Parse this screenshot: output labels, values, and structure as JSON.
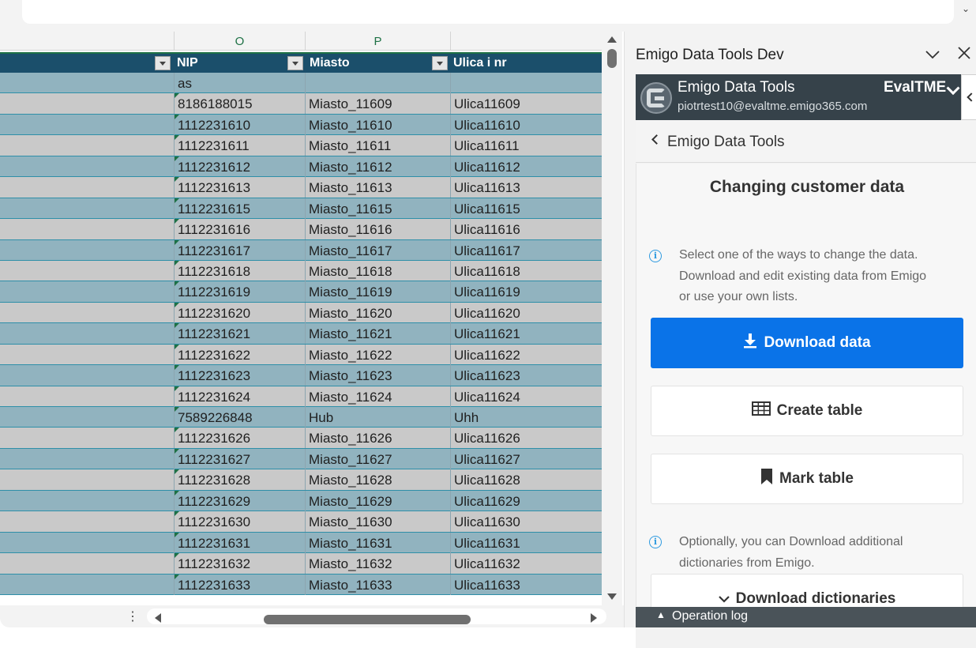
{
  "top": {
    "chevron": "⌄"
  },
  "sheet": {
    "column_letters": [
      "O",
      "P"
    ],
    "headers": {
      "nip": "NIP",
      "city": "Miasto",
      "street": "Ulica i nr"
    },
    "rows": [
      {
        "nip": "as",
        "city": "",
        "street": ""
      },
      {
        "nip": "8186188015",
        "city": "Miasto_11609",
        "street": "Ulica11609"
      },
      {
        "nip": "1112231610",
        "city": "Miasto_11610",
        "street": "Ulica11610"
      },
      {
        "nip": "1112231611",
        "city": "Miasto_11611",
        "street": "Ulica11611"
      },
      {
        "nip": "1112231612",
        "city": "Miasto_11612",
        "street": "Ulica11612"
      },
      {
        "nip": "1112231613",
        "city": "Miasto_11613",
        "street": "Ulica11613"
      },
      {
        "nip": "1112231615",
        "city": "Miasto_11615",
        "street": "Ulica11615"
      },
      {
        "nip": "1112231616",
        "city": "Miasto_11616",
        "street": "Ulica11616"
      },
      {
        "nip": "1112231617",
        "city": "Miasto_11617",
        "street": "Ulica11617"
      },
      {
        "nip": "1112231618",
        "city": "Miasto_11618",
        "street": "Ulica11618"
      },
      {
        "nip": "1112231619",
        "city": "Miasto_11619",
        "street": "Ulica11619"
      },
      {
        "nip": "1112231620",
        "city": "Miasto_11620",
        "street": "Ulica11620"
      },
      {
        "nip": "1112231621",
        "city": "Miasto_11621",
        "street": "Ulica11621"
      },
      {
        "nip": "1112231622",
        "city": "Miasto_11622",
        "street": "Ulica11622"
      },
      {
        "nip": "1112231623",
        "city": "Miasto_11623",
        "street": "Ulica11623"
      },
      {
        "nip": "1112231624",
        "city": "Miasto_11624",
        "street": "Ulica11624"
      },
      {
        "nip": "7589226848",
        "city": "Hub",
        "street": "Uhh"
      },
      {
        "nip": "1112231626",
        "city": "Miasto_11626",
        "street": "Ulica11626"
      },
      {
        "nip": "1112231627",
        "city": "Miasto_11627",
        "street": "Ulica11627"
      },
      {
        "nip": "1112231628",
        "city": "Miasto_11628",
        "street": "Ulica11628"
      },
      {
        "nip": "1112231629",
        "city": "Miasto_11629",
        "street": "Ulica11629"
      },
      {
        "nip": "1112231630",
        "city": "Miasto_11630",
        "street": "Ulica11630"
      },
      {
        "nip": "1112231631",
        "city": "Miasto_11631",
        "street": "Ulica11631"
      },
      {
        "nip": "1112231632",
        "city": "Miasto_11632",
        "street": "Ulica11632"
      },
      {
        "nip": "1112231633",
        "city": "Miasto_11633",
        "street": "Ulica11633"
      }
    ]
  },
  "bottom_bar": {
    "dots": "⋮"
  },
  "panel": {
    "title": "Emigo Data Tools Dev",
    "collapse_icon": "chevron-down-icon",
    "close_icon": "close-icon",
    "addin": {
      "name": "Emigo Data Tools",
      "email": "piotrtest10@evaltme.emigo365.com",
      "tenant": "EvalTME"
    },
    "nav": {
      "label": "Emigo Data Tools"
    },
    "section_title": "Changing customer data",
    "info_1": [
      "Select one of the ways to change the data.",
      "Download and edit existing data from Emigo",
      "or use your own lists."
    ],
    "buttons": {
      "download_data": "Download data",
      "create_table": "Create table",
      "mark_table": "Mark table",
      "download_dictionaries": "Download dictionaries"
    },
    "info_2": [
      "Optionally, you can Download additional",
      "dictionaries from Emigo."
    ],
    "operation_log": "Operation log",
    "colors": {
      "primary": "#0a73e8",
      "header_dark": "#36424a",
      "table_header": "#1b4f6b"
    }
  }
}
